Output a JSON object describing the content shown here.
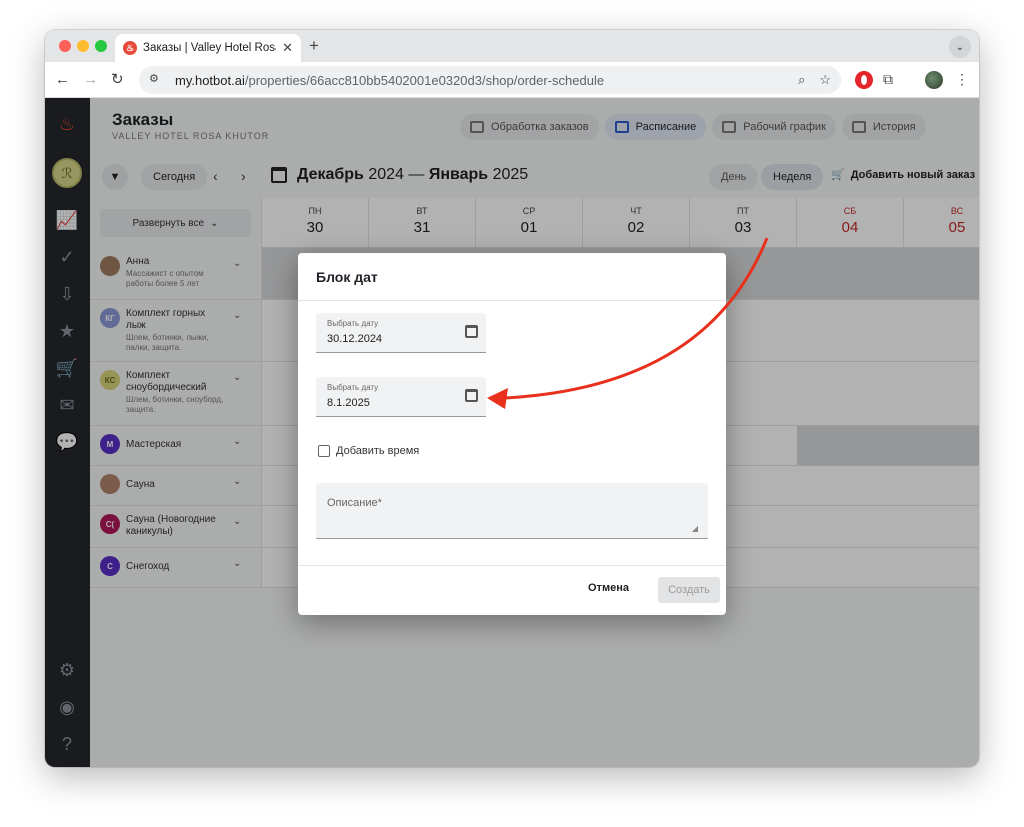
{
  "browser": {
    "tab_title": "Заказы | Valley Hotel Rosa Khutor",
    "url_host": "my.hotbot.ai",
    "url_path": "/properties/66acc810bb5402001e0320d3/shop/order-schedule"
  },
  "header": {
    "title": "Заказы",
    "subtitle": "VALLEY HOTEL ROSA KHUTOR",
    "tabs": [
      {
        "label": "Обработка заказов",
        "icon": "inbox-icon"
      },
      {
        "label": "Расписание",
        "icon": "calendar-icon"
      },
      {
        "label": "Рабочий график",
        "icon": "people-icon"
      },
      {
        "label": "История",
        "icon": "history-icon"
      }
    ]
  },
  "controls": {
    "today": "Сегодня",
    "range_month1": "Декабрь",
    "range_year1": "2024",
    "range_sep": "—",
    "range_month2": "Январь",
    "range_year2": "2025",
    "day_view": "День",
    "week_view": "Неделя",
    "add_order": "Добавить новый заказ",
    "expand_all": "Развернуть все"
  },
  "days": [
    {
      "name": "ПН",
      "num": "30",
      "weekend": false
    },
    {
      "name": "ВТ",
      "num": "31",
      "weekend": false
    },
    {
      "name": "СР",
      "num": "01",
      "weekend": false
    },
    {
      "name": "ЧТ",
      "num": "02",
      "weekend": false
    },
    {
      "name": "ПТ",
      "num": "03",
      "weekend": false
    },
    {
      "name": "СБ",
      "num": "04",
      "weekend": true
    },
    {
      "name": "ВС",
      "num": "05",
      "weekend": true
    }
  ],
  "resources": [
    {
      "name": "Анна",
      "desc": "Массажист с опытом работы более 5 лет",
      "initials": "",
      "color": "#a07a5f"
    },
    {
      "name": "Комплект горных лыж",
      "desc": "Шлем, ботинки, лыжи, палки, защита.",
      "initials": "КГ",
      "color": "#8a9bd6"
    },
    {
      "name": "Комплект сноубордический",
      "desc": "Шлем, ботинки, сноуборд, защита.",
      "initials": "КС",
      "color": "#d9d47a"
    },
    {
      "name": "Мастерская",
      "desc": "",
      "initials": "М",
      "color": "#5a2fc7"
    },
    {
      "name": "Сауна",
      "desc": "",
      "initials": "",
      "color": "#b0856b"
    },
    {
      "name": "Сауна (Новогодние каникулы)",
      "desc": "",
      "initials": "С(",
      "color": "#b0175b"
    },
    {
      "name": "Снегоход",
      "desc": "",
      "initials": "С",
      "color": "#5a2fc7"
    }
  ],
  "modal": {
    "title": "Блок дат",
    "date_label_1": "Выбрать дату",
    "date_value_1": "30.12.2024",
    "date_label_2": "Выбрать дату",
    "date_value_2": "8.1.2025",
    "add_time": "Добавить время",
    "description_label": "Описание*",
    "cancel": "Отмена",
    "create": "Создать"
  },
  "colors": {
    "sidebar": "#24272d",
    "accent": "#2f5bd3",
    "weekend": "#c62828",
    "annotation": "#e8301c"
  }
}
